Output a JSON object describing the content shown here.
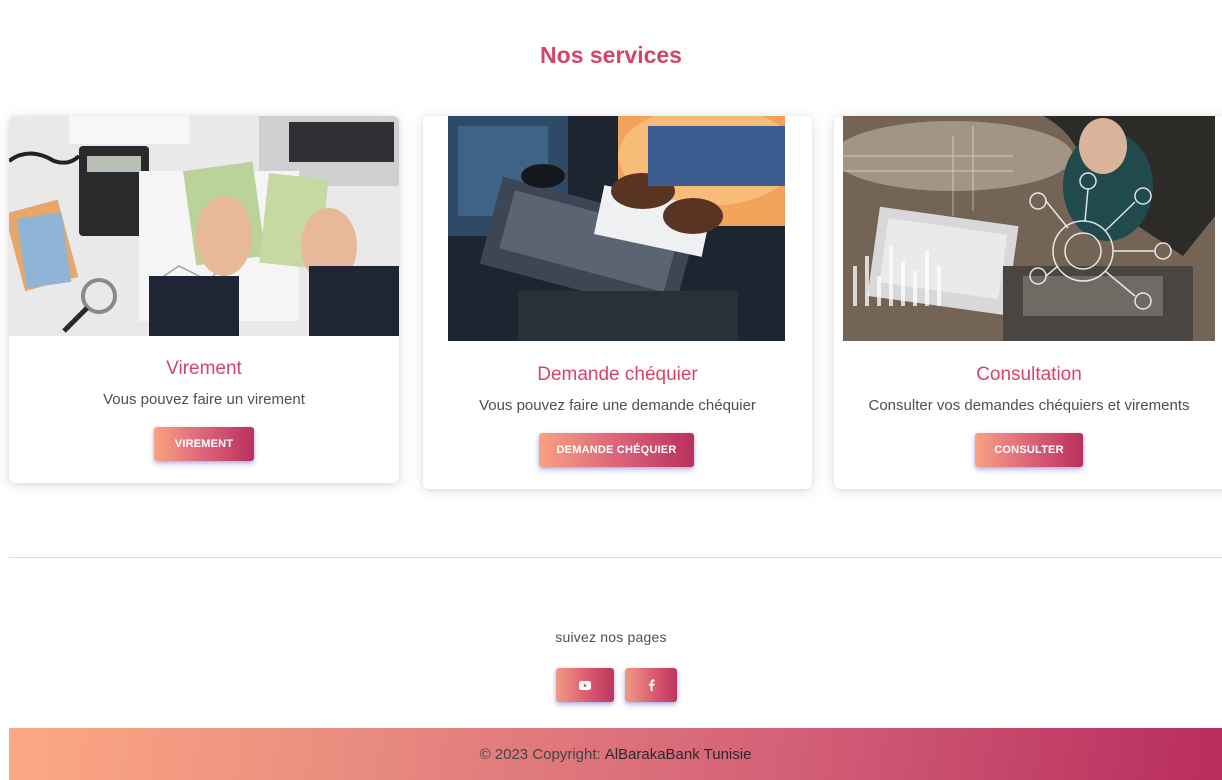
{
  "section": {
    "title": "Nos services"
  },
  "services": [
    {
      "title": "Virement",
      "description": "Vous pouvez faire un virement",
      "button": "VIREMENT"
    },
    {
      "title": "Demande chéquier",
      "description": "Vous pouvez faire une demande chéquier",
      "button": "DEMANDE CHÉQUIER"
    },
    {
      "title": "Consultation",
      "description": "Consulter vos demandes chéquiers et virements",
      "button": "CONSULTER"
    }
  ],
  "social": {
    "label": "suivez nos pages",
    "links": [
      {
        "icon": "youtube-icon"
      },
      {
        "icon": "facebook-icon"
      }
    ]
  },
  "footer": {
    "copyright": "© 2023 Copyright:",
    "brand": "AlBarakaBank Tunisie"
  },
  "colors": {
    "accent": "#d6436b",
    "gradient_start": "#fda983",
    "gradient_end": "#b82c5e"
  }
}
